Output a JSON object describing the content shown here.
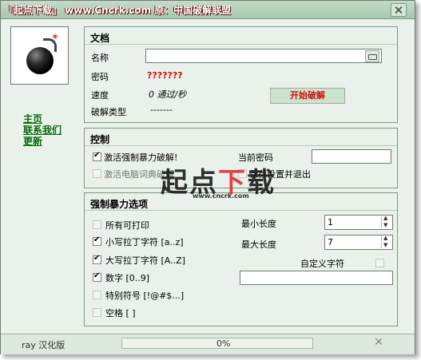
{
  "titlebar": {
    "title": "『起点下载』 www.Cncrk.com 原：中国破解联盟"
  },
  "nav": {
    "home": "主页",
    "contact": "联系我们",
    "update": "更新"
  },
  "document_group": {
    "title": "文档",
    "name_label": "名称",
    "name_value": "",
    "password_label": "密码",
    "password_value": "???????",
    "speed_label": "速度",
    "speed_value": "0 通过/秒",
    "crack_type_label": "破解类型",
    "crack_type_value": "-------",
    "start_button": "开始破解"
  },
  "control_group": {
    "title": "控制",
    "brute_force_label": "激活强制暴力破解!",
    "brute_force_checked": true,
    "dictionary_label": "激活电脑词典破解",
    "dictionary_checked": false,
    "current_password_label": "当前密码",
    "current_password_value": "",
    "save_exit_label": "保存设置并退出",
    "save_exit_checked": false
  },
  "brute_options": {
    "title": "强制暴力选项",
    "printable_label": "所有可打印",
    "printable_checked": false,
    "lowercase_label": "小写拉丁字符 [a..z]",
    "lowercase_checked": true,
    "uppercase_label": "大写拉丁字符 [A..Z]",
    "uppercase_checked": true,
    "digits_label": "数字 [0..9]",
    "digits_checked": true,
    "special_label": "特别符号 [!@#$...]",
    "special_checked": false,
    "space_label": "空格 [ ]",
    "space_checked": false,
    "min_length_label": "最小长度",
    "min_length_value": "1",
    "max_length_label": "最大长度",
    "max_length_value": "7",
    "custom_chars_label": "自定义字符",
    "custom_chars_checked": false,
    "custom_chars_value": ""
  },
  "statusbar": {
    "left_text": "ray 汉化版",
    "progress_text": "0%",
    "progress_percent": 0
  },
  "watermark": {
    "text_left": "起点",
    "text_mid": "下",
    "text_right": "载",
    "sub": "www.cncrk.com"
  }
}
